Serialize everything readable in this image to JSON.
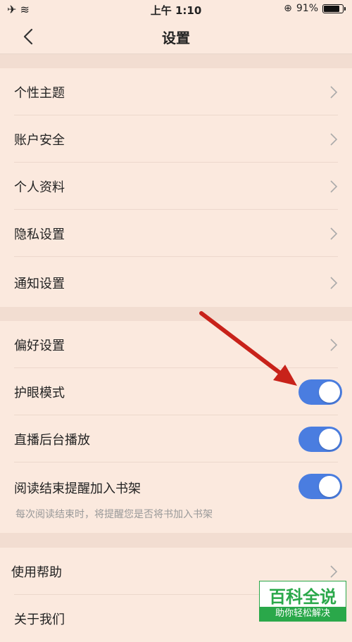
{
  "status_bar": {
    "time": "上午 1:10",
    "battery": "91%"
  },
  "header": {
    "title": "设置"
  },
  "group1": [
    {
      "label": "个性主题"
    },
    {
      "label": "账户安全"
    },
    {
      "label": "个人资料"
    },
    {
      "label": "隐私设置"
    },
    {
      "label": "通知设置"
    }
  ],
  "group2": {
    "preferences": {
      "label": "偏好设置"
    },
    "eye_care": {
      "label": "护眼模式",
      "on": true
    },
    "background_play": {
      "label": "直播后台播放",
      "on": true
    },
    "add_to_shelf": {
      "label": "阅读结束提醒加入书架",
      "on": true,
      "description": "每次阅读结束时，将提醒您是否将书加入书架"
    }
  },
  "group3": [
    {
      "label": "使用帮助"
    },
    {
      "label": "关于我们"
    }
  ],
  "watermark": {
    "title": "百科全说",
    "subtitle": "助你轻松解决"
  },
  "colors": {
    "background": "#fbe9de",
    "toggle_on": "#4a7de0",
    "annotation_arrow": "#c8221a",
    "watermark": "#2aa84a"
  }
}
